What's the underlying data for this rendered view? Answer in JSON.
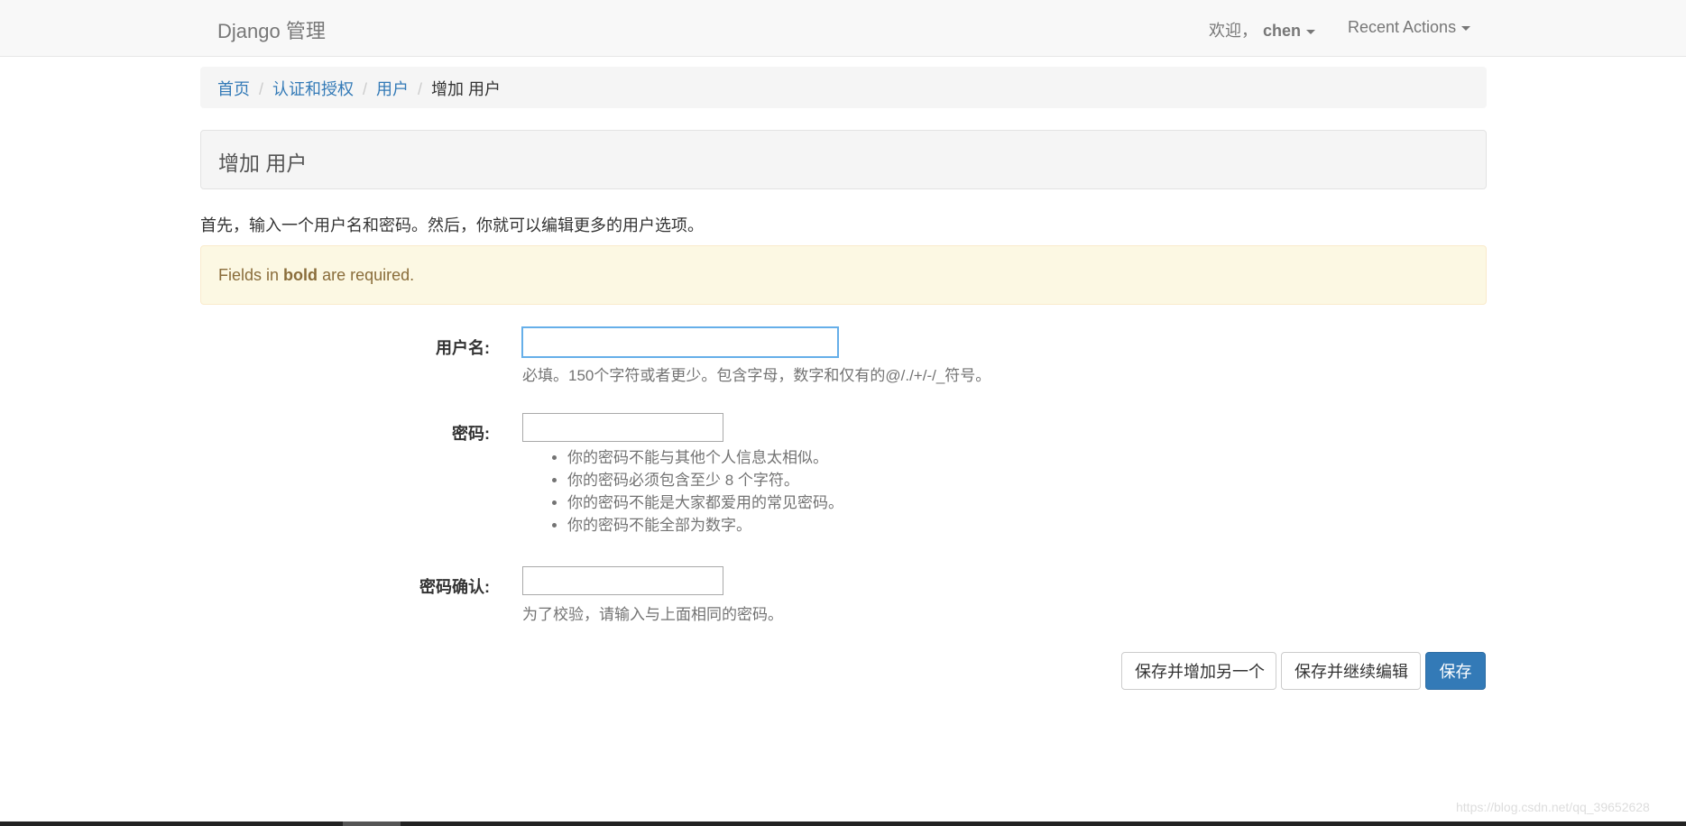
{
  "navbar": {
    "brand": "Django 管理",
    "welcome": "欢迎，",
    "username": "chen",
    "recent_actions": "Recent Actions"
  },
  "breadcrumb": {
    "home": "首页",
    "app": "认证和授权",
    "model": "用户",
    "current": "增加 用户",
    "separator": "/"
  },
  "page": {
    "title": "增加 用户",
    "intro": "首先，输入一个用户名和密码。然后，你就可以编辑更多的用户选项。"
  },
  "alert": {
    "prefix": "Fields in",
    "bold": "bold",
    "suffix": "are required."
  },
  "form": {
    "username": {
      "label": "用户名:",
      "value": "",
      "help": "必填。150个字符或者更少。包含字母，数字和仅有的@/./+/-/_符号。"
    },
    "password1": {
      "label": "密码:",
      "value": "",
      "help": [
        "你的密码不能与其他个人信息太相似。",
        "你的密码必须包含至少 8 个字符。",
        "你的密码不能是大家都爱用的常见密码。",
        "你的密码不能全部为数字。"
      ]
    },
    "password2": {
      "label": "密码确认:",
      "value": "",
      "help": "为了校验，请输入与上面相同的密码。"
    }
  },
  "buttons": {
    "save_add_another": "保存并增加另一个",
    "save_continue": "保存并继续编辑",
    "save": "保存"
  },
  "watermark": "https://blog.csdn.net/qq_39652628",
  "colors": {
    "link": "#337ab7",
    "primary_button": "#337ab7",
    "alert_bg": "#fcf8e3",
    "alert_text": "#8a6d3b"
  }
}
